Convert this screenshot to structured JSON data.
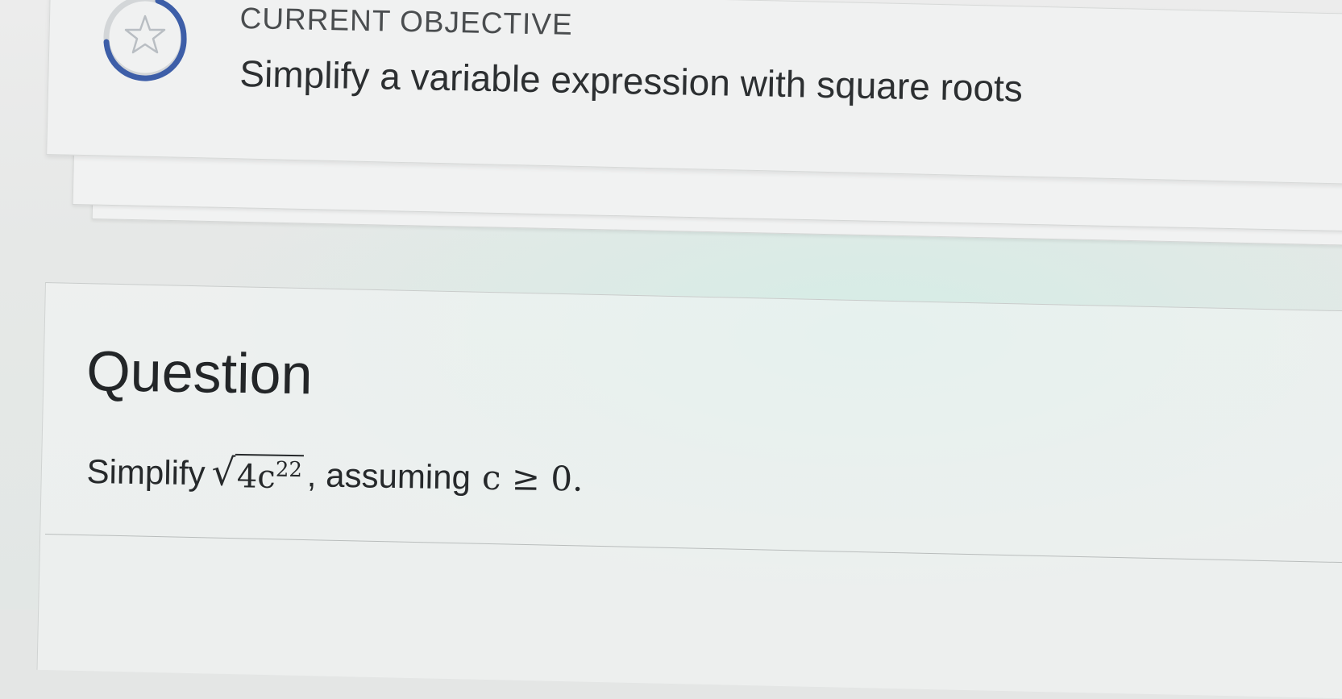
{
  "objective": {
    "label": "CURRENT OBJECTIVE",
    "title": "Simplify a variable expression with square roots",
    "icon": "star-icon",
    "ring_color": "#3d5ea8"
  },
  "question": {
    "heading": "Question",
    "prompt_prefix": "Simplify",
    "radicand_base": "4c",
    "radicand_exponent": "22",
    "prompt_middle": ", assuming",
    "condition": "c ≥ 0",
    "prompt_end": "."
  }
}
